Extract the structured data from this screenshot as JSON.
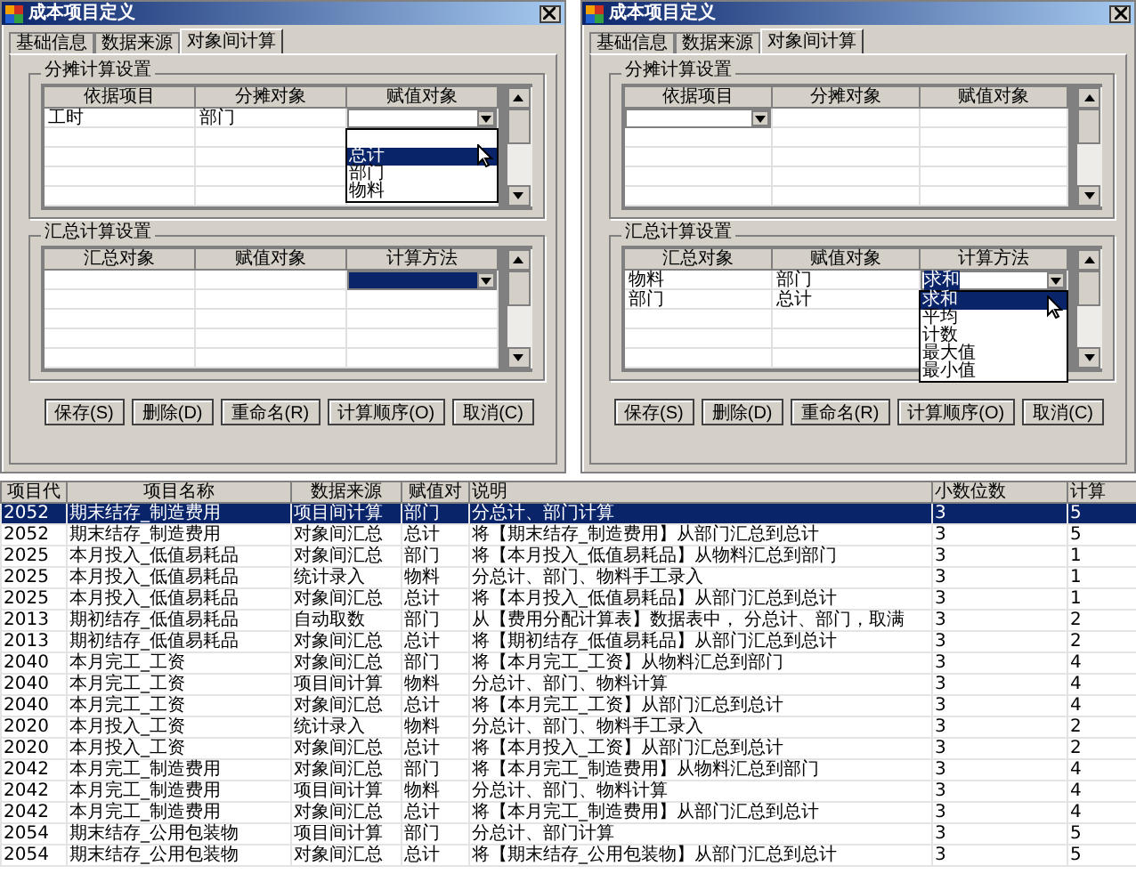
{
  "dialogs": [
    {
      "title": "成本项目定义",
      "tabs": [
        {
          "label": "基础信息",
          "selected": false
        },
        {
          "label": "数据来源",
          "selected": false
        },
        {
          "label": "对象间计算",
          "selected": true
        }
      ],
      "groups": [
        {
          "title": "分摊计算设置",
          "columns": [
            "依据项目",
            "分摊对象",
            "赋值对象"
          ],
          "rows": [
            [
              {
                "kind": "text",
                "text": "工时"
              },
              {
                "kind": "text",
                "text": "部门"
              },
              {
                "kind": "combo",
                "selected": false,
                "options": [
                  {
                    "label": "总计",
                    "selected": true
                  },
                  {
                    "label": "部门",
                    "selected": false
                  },
                  {
                    "label": "物料",
                    "selected": false
                  }
                ]
              }
            ]
          ]
        },
        {
          "title": "汇总计算设置",
          "columns": [
            "汇总对象",
            "赋值对象",
            "计算方法"
          ],
          "rows": [
            [
              {
                "kind": "blank"
              },
              {
                "kind": "blank"
              },
              {
                "kind": "combo",
                "selected": true
              }
            ]
          ]
        }
      ],
      "buttons": [
        "保存(S)",
        "删除(D)",
        "重命名(R)",
        "计算顺序(O)",
        "取消(C)"
      ]
    },
    {
      "title": "成本项目定义",
      "tabs": [
        {
          "label": "基础信息",
          "selected": false
        },
        {
          "label": "数据来源",
          "selected": false
        },
        {
          "label": "对象间计算",
          "selected": true
        }
      ],
      "groups": [
        {
          "title": "分摊计算设置",
          "columns": [
            "依据项目",
            "分摊对象",
            "赋值对象"
          ],
          "rows": [
            [
              {
                "kind": "combo",
                "selected": false
              },
              {
                "kind": "blank"
              },
              {
                "kind": "blank"
              }
            ]
          ]
        },
        {
          "title": "汇总计算设置",
          "columns": [
            "汇总对象",
            "赋值对象",
            "计算方法"
          ],
          "rows": [
            [
              {
                "kind": "text",
                "text": "物料"
              },
              {
                "kind": "text",
                "text": "部门"
              },
              {
                "kind": "combo",
                "value": "求和",
                "selected": false,
                "value_selected": true,
                "options": [
                  {
                    "label": "求和",
                    "selected": true
                  },
                  {
                    "label": "平均",
                    "selected": false
                  },
                  {
                    "label": "计数",
                    "selected": false
                  },
                  {
                    "label": "最大值",
                    "selected": false
                  },
                  {
                    "label": "最小值",
                    "selected": false
                  }
                ]
              }
            ],
            [
              {
                "kind": "text",
                "text": "部门"
              },
              {
                "kind": "text",
                "text": "总计"
              },
              {
                "kind": "blank"
              }
            ]
          ]
        }
      ],
      "buttons": [
        "保存(S)",
        "删除(D)",
        "重命名(R)",
        "计算顺序(O)",
        "取消(C)"
      ]
    }
  ],
  "table": {
    "columns": [
      "项目代",
      "项目名称",
      "数据来源",
      "赋值对",
      "说明",
      "小数位数",
      "计算"
    ],
    "rows": [
      {
        "selected": true,
        "cells": [
          "2052",
          "期末结存_制造费用",
          "项目间计算",
          "部门",
          "分总计、部门计算",
          "3",
          "5"
        ]
      },
      {
        "selected": false,
        "cells": [
          "2052",
          "期末结存_制造费用",
          "对象间汇总",
          "总计",
          "将【期末结存_制造费用】从部门汇总到总计",
          "3",
          "5"
        ]
      },
      {
        "selected": false,
        "cells": [
          "2025",
          "本月投入_低值易耗品",
          "对象间汇总",
          "部门",
          "将【本月投入_低值易耗品】从物料汇总到部门",
          "3",
          "1"
        ]
      },
      {
        "selected": false,
        "cells": [
          "2025",
          "本月投入_低值易耗品",
          "统计录入",
          "物料",
          "分总计、部门、物料手工录入",
          "3",
          "1"
        ]
      },
      {
        "selected": false,
        "cells": [
          "2025",
          "本月投入_低值易耗品",
          "对象间汇总",
          "总计",
          "将【本月投入_低值易耗品】从部门汇总到总计",
          "3",
          "1"
        ]
      },
      {
        "selected": false,
        "cells": [
          "2013",
          "期初结存_低值易耗品",
          "自动取数",
          "部门",
          "从【费用分配计算表】数据表中， 分总计、部门，取满",
          "3",
          "2"
        ]
      },
      {
        "selected": false,
        "cells": [
          "2013",
          "期初结存_低值易耗品",
          "对象间汇总",
          "总计",
          "将【期初结存_低值易耗品】从部门汇总到总计",
          "3",
          "2"
        ]
      },
      {
        "selected": false,
        "cells": [
          "2040",
          "本月完工_工资",
          "对象间汇总",
          "部门",
          "将【本月完工_工资】从物料汇总到部门",
          "3",
          "4"
        ]
      },
      {
        "selected": false,
        "cells": [
          "2040",
          "本月完工_工资",
          "项目间计算",
          "物料",
          "分总计、部门、物料计算",
          "3",
          "4"
        ]
      },
      {
        "selected": false,
        "cells": [
          "2040",
          "本月完工_工资",
          "对象间汇总",
          "总计",
          "将【本月完工_工资】从部门汇总到总计",
          "3",
          "4"
        ]
      },
      {
        "selected": false,
        "cells": [
          "2020",
          "本月投入_工资",
          "统计录入",
          "物料",
          "分总计、部门、物料手工录入",
          "3",
          "2"
        ]
      },
      {
        "selected": false,
        "cells": [
          "2020",
          "本月投入_工资",
          "对象间汇总",
          "总计",
          "将【本月投入_工资】从部门汇总到总计",
          "3",
          "2"
        ]
      },
      {
        "selected": false,
        "cells": [
          "2042",
          "本月完工_制造费用",
          "对象间汇总",
          "部门",
          "将【本月完工_制造费用】从物料汇总到部门",
          "3",
          "4"
        ]
      },
      {
        "selected": false,
        "cells": [
          "2042",
          "本月完工_制造费用",
          "项目间计算",
          "物料",
          "分总计、部门、物料计算",
          "3",
          "4"
        ]
      },
      {
        "selected": false,
        "cells": [
          "2042",
          "本月完工_制造费用",
          "对象间汇总",
          "总计",
          "将【本月完工_制造费用】从部门汇总到总计",
          "3",
          "4"
        ]
      },
      {
        "selected": false,
        "cells": [
          "2054",
          "期末结存_公用包装物",
          "项目间计算",
          "部门",
          "分总计、部门计算",
          "3",
          "5"
        ]
      },
      {
        "selected": false,
        "cells": [
          "2054",
          "期末结存_公用包装物",
          "对象间汇总",
          "总计",
          "将【期末结存_公用包装物】从部门汇总到总计",
          "3",
          "5"
        ]
      }
    ]
  }
}
